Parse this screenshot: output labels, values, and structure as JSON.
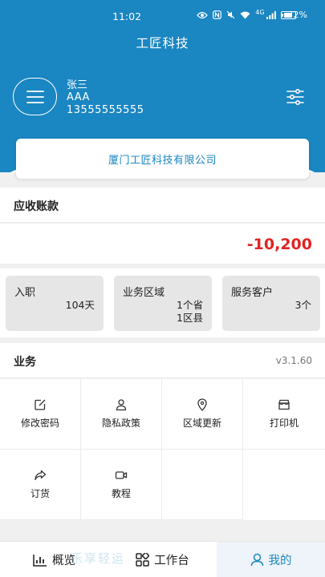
{
  "status_bar": {
    "time": "11:02",
    "battery": "72%",
    "battery_level": 0.72,
    "signal_label": "4G"
  },
  "header": {
    "title": "工匠科技"
  },
  "user": {
    "name": "张三",
    "nickname": "AAA",
    "phone": "13555555555"
  },
  "company": {
    "name": "厦门工匠科技有限公司"
  },
  "receivable": {
    "label": "应收账款",
    "amount": "-10,200"
  },
  "stats": [
    {
      "title": "入职",
      "value_lines": [
        "104天"
      ]
    },
    {
      "title": "业务区域",
      "value_lines": [
        "1个省",
        "1区县"
      ]
    },
    {
      "title": "服务客户",
      "value_lines": [
        "3个"
      ]
    }
  ],
  "business": {
    "label": "业务",
    "version": "v3.1.60",
    "items": [
      {
        "label": "修改密码",
        "icon": "edit-icon"
      },
      {
        "label": "隐私政策",
        "icon": "user-icon"
      },
      {
        "label": "区域更新",
        "icon": "location-icon"
      },
      {
        "label": "打印机",
        "icon": "printer-icon"
      },
      {
        "label": "订货",
        "icon": "share-icon"
      },
      {
        "label": "教程",
        "icon": "video-icon"
      }
    ]
  },
  "tabbar": [
    {
      "label": "概览",
      "icon": "chart-icon",
      "active": false
    },
    {
      "label": "工作台",
      "icon": "grid-icon",
      "active": false
    },
    {
      "label": "我的",
      "icon": "profile-icon",
      "active": true
    }
  ],
  "watermark": "乐享轻运",
  "colors": {
    "primary": "#1a86c2",
    "negative": "#e02424",
    "card_gray": "#e6e6e6"
  }
}
